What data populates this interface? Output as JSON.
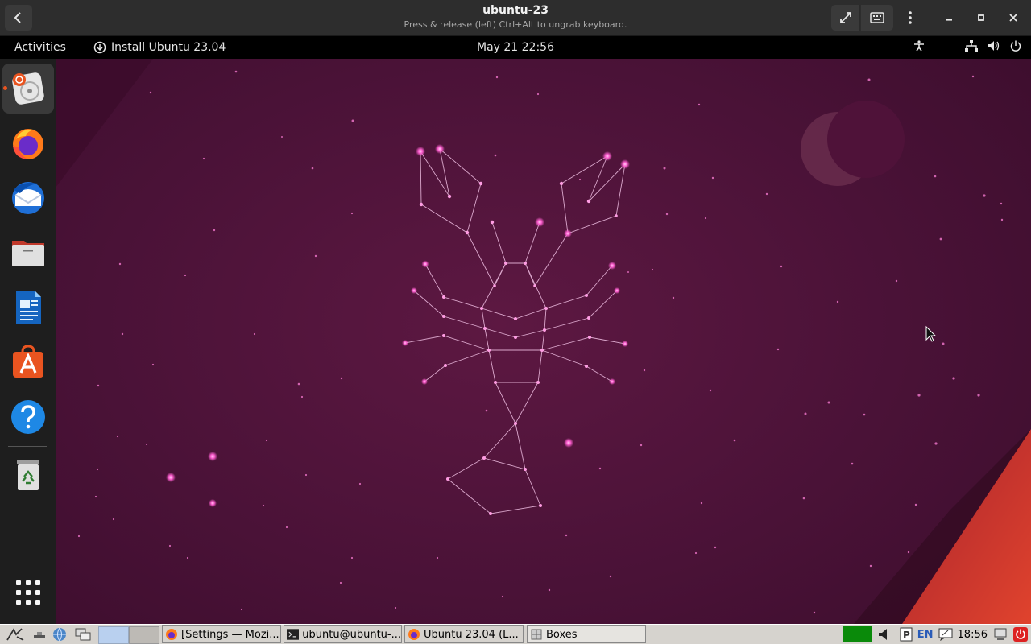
{
  "header": {
    "title": "ubuntu-23",
    "subtitle": "Press & release (left) Ctrl+Alt to ungrab keyboard."
  },
  "topbar": {
    "activities": "Activities",
    "install_label": "Install Ubuntu 23.04",
    "clock": "May 21  22:56"
  },
  "dock": {
    "items": [
      "ubuntu-installer-icon",
      "firefox-icon",
      "thunderbird-icon",
      "files-icon",
      "writer-icon",
      "app-center-icon",
      "help-icon",
      "trash-icon"
    ]
  },
  "taskbar": {
    "tasks": [
      "[Settings — Mozi...",
      "ubuntu@ubuntu-...",
      "Ubuntu 23.04 (L...",
      "Boxes"
    ],
    "lang": "EN",
    "time": "18:56"
  },
  "colors": {
    "accent": "#e95420",
    "wallpaper": "#4a1237",
    "star": "#ff5fd1"
  }
}
